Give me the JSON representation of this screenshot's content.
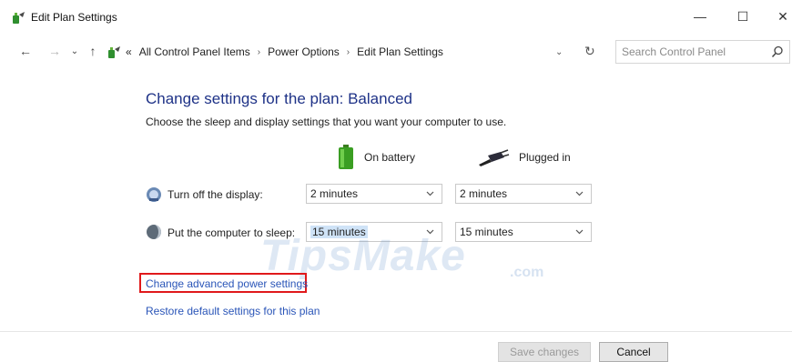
{
  "window": {
    "title": "Edit Plan Settings",
    "minimize": "—",
    "maximize": "☐",
    "close": "✕"
  },
  "address": {
    "back": "←",
    "forward": "→",
    "history": "⌄",
    "up": "↑",
    "overflow": "«",
    "crumbs": [
      "All Control Panel Items",
      "Power Options",
      "Edit Plan Settings"
    ],
    "separator": "›",
    "dropdown": "⌄",
    "refresh": "↻"
  },
  "search": {
    "placeholder": "Search Control Panel"
  },
  "main": {
    "heading": "Change settings for the plan: Balanced",
    "subtext": "Choose the sleep and display settings that you want your computer to use.",
    "col_battery": "On battery",
    "col_plugged": "Plugged in",
    "rows": [
      {
        "label": "Turn off the display:",
        "battery": "2 minutes",
        "plugged": "2 minutes"
      },
      {
        "label": "Put the computer to sleep:",
        "battery": "15 minutes",
        "plugged": "15 minutes"
      }
    ],
    "advanced_link": "Change advanced power settings",
    "restore_link": "Restore default settings for this plan"
  },
  "watermark": {
    "main": "TipsMake",
    "suffix": ".com"
  },
  "footer": {
    "save": "Save changes",
    "cancel": "Cancel"
  },
  "colors": {
    "heading": "#1e3287",
    "link": "#2a55b8",
    "highlight_box": "#e0191b"
  }
}
